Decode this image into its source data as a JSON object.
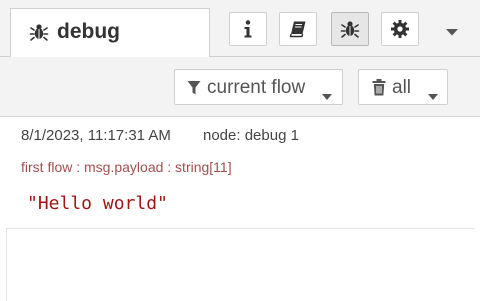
{
  "sidebar": {
    "active_tab": {
      "label": "debug",
      "icon": "bug-icon"
    },
    "tab_buttons": [
      {
        "name": "info",
        "icon": "info-icon",
        "selected": false
      },
      {
        "name": "help",
        "icon": "book-icon",
        "selected": false
      },
      {
        "name": "debug",
        "icon": "bug-icon",
        "selected": true
      },
      {
        "name": "config",
        "icon": "gear-icon",
        "selected": false
      }
    ]
  },
  "toolbar": {
    "filter_label": "current flow",
    "clear_label": "all"
  },
  "messages": [
    {
      "timestamp": "8/1/2023, 11:17:31 AM",
      "node": "node: debug 1",
      "meta": "first flow : msg.payload : string[11]",
      "value": "\"Hello world\""
    }
  ],
  "colors": {
    "meta_text": "#a05050",
    "value_text": "#a31515",
    "chrome": "#f3f3f3"
  }
}
